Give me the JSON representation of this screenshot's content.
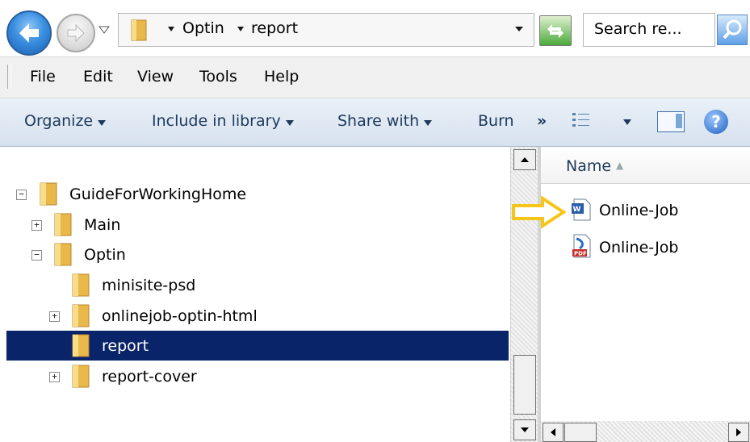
{
  "address_bar": {
    "breadcrumbs": [
      "Optin",
      "report"
    ],
    "search_placeholder": "Search re..."
  },
  "menu": [
    "File",
    "Edit",
    "View",
    "Tools",
    "Help"
  ],
  "command_bar": {
    "organize": "Organize",
    "include_in_library": "Include in library",
    "share_with": "Share with",
    "burn": "Burn",
    "overflow": "»",
    "help": "?"
  },
  "tree": [
    {
      "label": "GuideForWorkingHome",
      "expander": "−"
    },
    {
      "label": "Main",
      "expander": "+"
    },
    {
      "label": "Optin",
      "expander": "−"
    },
    {
      "label": "minisite-psd",
      "expander": ""
    },
    {
      "label": "onlinejob-optin-html",
      "expander": "+"
    },
    {
      "label": "report",
      "expander": "",
      "selected": true
    },
    {
      "label": "report-cover",
      "expander": "+"
    }
  ],
  "file_list": {
    "column_name": "Name",
    "files": [
      {
        "name": "Online-Job",
        "icon": "word-document-icon"
      },
      {
        "name": "Online-Job",
        "icon": "pdf-document-icon"
      }
    ]
  },
  "colors": {
    "selection": "#0a246a",
    "highlight_arrow": "#f5c518",
    "command_text": "#1e395b"
  }
}
